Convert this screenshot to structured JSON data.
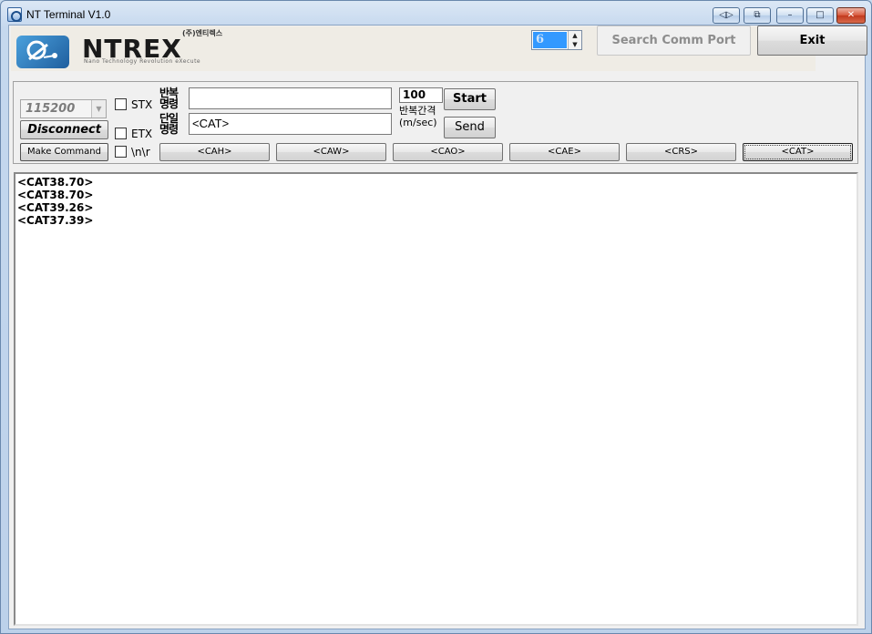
{
  "window": {
    "title": "NT Terminal V1.0",
    "controls": {
      "left_right": "◁▷",
      "restore_alt": "⧉",
      "minimize": "–",
      "maximize": "□",
      "close": "✕"
    }
  },
  "header": {
    "logo_text": "NTREX",
    "logo_korean": "(주)엔티렉스",
    "logo_subtitle": "Nano Technology Revolution eXecute",
    "port_number": "6",
    "search_button": "Search Comm Port",
    "exit_button": "Exit"
  },
  "panel": {
    "baud_rate": "115200",
    "disconnect_button": "Disconnect",
    "make_command_button": "Make Command",
    "stx_label": "STX",
    "etx_label": "ETX",
    "nr_label": "\\n\\r",
    "repeat_cmd_label": "반복\n명령",
    "single_cmd_label": "단일\n명령",
    "repeat_cmd_value": "",
    "single_cmd_value": "<CAT>",
    "interval_value": "100",
    "interval_label_1": "반복간격",
    "interval_label_2": "(m/sec)",
    "start_button": "Start",
    "send_button": "Send",
    "commands": [
      "<CAH>",
      "<CAW>",
      "<CAO>",
      "<CAE>",
      "<CRS>",
      "<CAT>"
    ],
    "active_command": "<CAT>"
  },
  "output": {
    "lines": [
      "<CAT38.70>",
      "<CAT38.70>",
      "<CAT39.26>",
      "<CAT37.39>"
    ]
  },
  "icons": {
    "app_icon": "terminal-app-icon",
    "logo_icon": "ntrex-logo-icon",
    "spin_up": "▲",
    "spin_down": "▼",
    "dropdown": "▼"
  }
}
